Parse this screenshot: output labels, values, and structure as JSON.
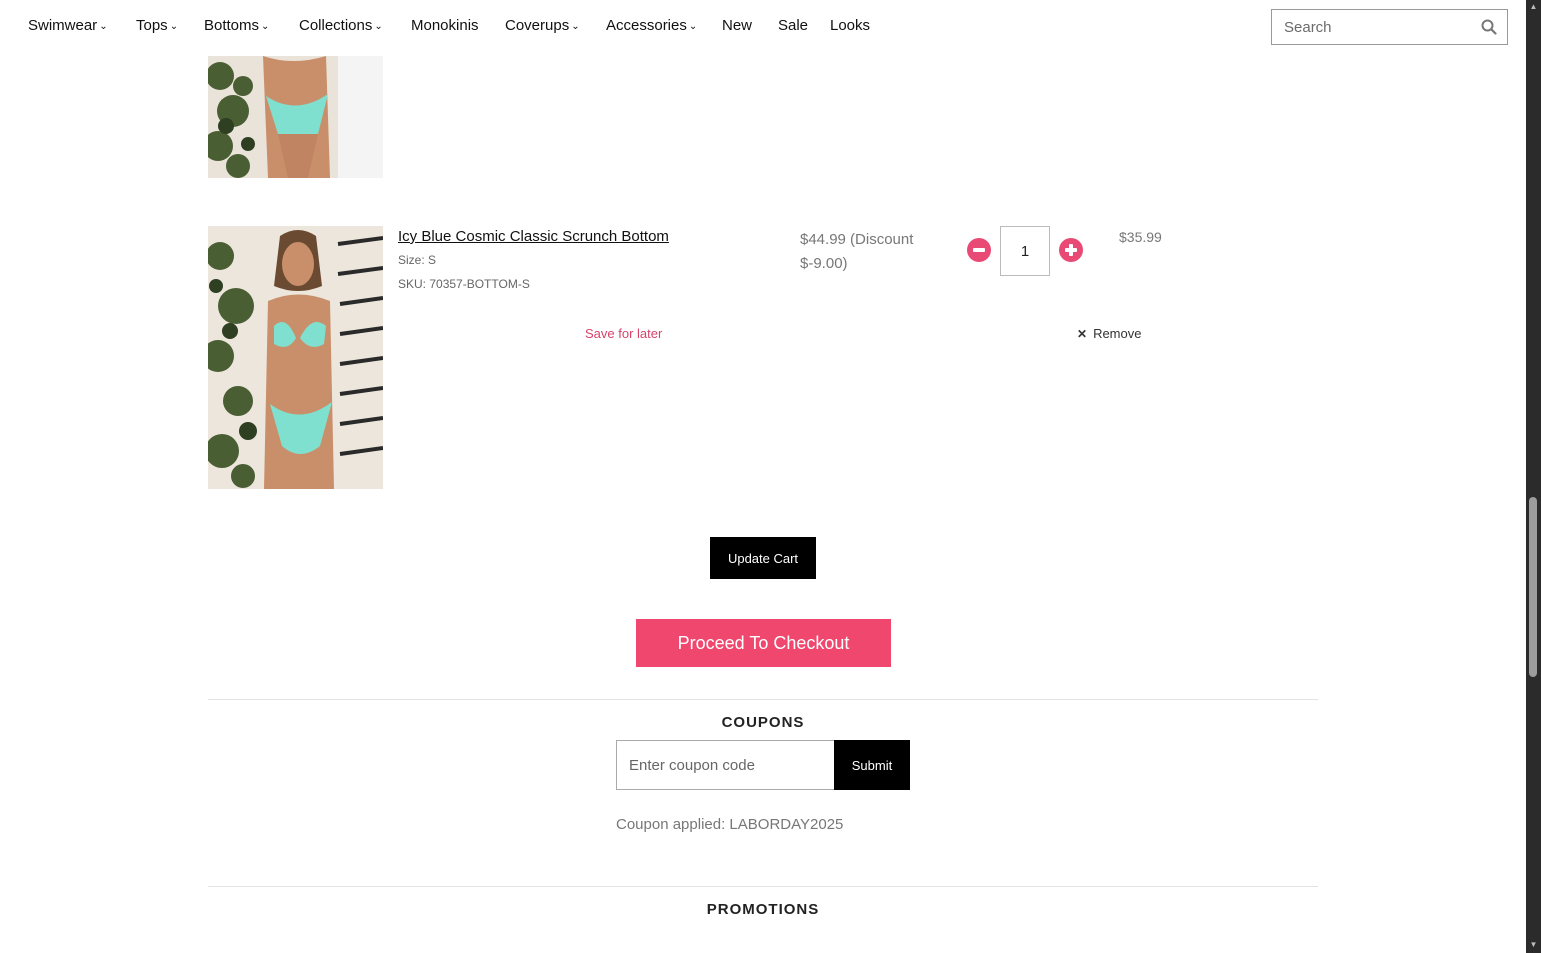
{
  "nav": {
    "items": [
      {
        "label": "Swimwear",
        "dropdown": true
      },
      {
        "label": "Tops",
        "dropdown": true
      },
      {
        "label": "Bottoms",
        "dropdown": true
      },
      {
        "label": "Collections",
        "dropdown": true
      },
      {
        "label": "Monokinis",
        "dropdown": false
      },
      {
        "label": "Coverups",
        "dropdown": true
      },
      {
        "label": "Accessories",
        "dropdown": true
      },
      {
        "label": "New",
        "dropdown": false
      },
      {
        "label": "Sale",
        "dropdown": false
      },
      {
        "label": "Looks",
        "dropdown": false
      }
    ],
    "search_placeholder": "Search",
    "search_icon": "search-icon"
  },
  "cart": {
    "item": {
      "name": "Icy Blue Cosmic Classic Scrunch Bottom",
      "size": "Size: S",
      "sku": "SKU: 70357-BOTTOM-S",
      "price": "$44.99 (Discount $-9.00)",
      "quantity": "1",
      "line_total": "$35.99",
      "save_for_later": "Save for later",
      "remove": "Remove"
    },
    "update_label": "Update Cart",
    "checkout_label": "Proceed To Checkout"
  },
  "coupons": {
    "title": "COUPONS",
    "placeholder": "Enter coupon code",
    "submit_label": "Submit",
    "applied_text": "Coupon applied: LABORDAY2025"
  },
  "promotions": {
    "title": "PROMOTIONS"
  },
  "colors": {
    "accent": "#f0476f",
    "qty_button": "#e84a75",
    "save_link": "#d8436a",
    "button_dark": "#000000"
  }
}
